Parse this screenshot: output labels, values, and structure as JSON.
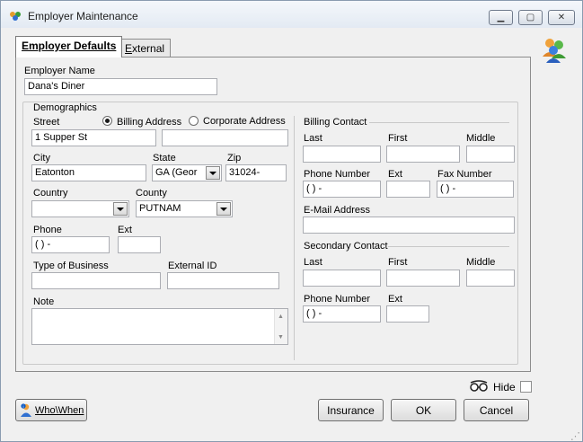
{
  "window": {
    "title": "Employer Maintenance",
    "min_glyph": "▁",
    "max_glyph": "▢",
    "close_glyph": "✕"
  },
  "tabs": {
    "active": "Employer Defaults",
    "inactive_first": "E",
    "inactive_rest": "xternal"
  },
  "employer": {
    "name_label": "Employer Name",
    "name_value": "Dana's Diner"
  },
  "demographics": {
    "title": "Demographics",
    "street_label": "Street",
    "billing_address": "Billing Address",
    "corporate_address": "Corporate Address",
    "street_value": "1 Supper St",
    "street2_value": "",
    "city_label": "City",
    "city_value": "Eatonton",
    "state_label": "State",
    "state_value": "GA  (Geor",
    "zip_label": "Zip",
    "zip_value": "31024-",
    "country_label": "Country",
    "country_value": "",
    "county_label": "County",
    "county_value": "PUTNAM",
    "phone_label": "Phone",
    "phone_value": "(   )    -",
    "ext_label": "Ext",
    "ext_value": "",
    "type_label": "Type of Business",
    "type_value": "",
    "external_id_label": "External ID",
    "external_id_value": "",
    "note_label": "Note",
    "note_value": ""
  },
  "billing_contact": {
    "title": "Billing Contact",
    "last_label": "Last",
    "first_label": "First",
    "middle_label": "Middle",
    "phone_label": "Phone Number",
    "ext_label": "Ext",
    "fax_label": "Fax Number",
    "phone_value": "(   )    -",
    "fax_value": "(   )    -",
    "email_label": "E-Mail Address"
  },
  "secondary_contact": {
    "title": "Secondary Contact",
    "last_label": "Last",
    "first_label": "First",
    "middle_label": "Middle",
    "phone_label": "Phone Number",
    "ext_label": "Ext",
    "phone_value": "(   )    -"
  },
  "footer": {
    "hide_label": "Hide",
    "whowhen_label": "Who\\When",
    "insurance_label": "Insurance",
    "ok_label": "OK",
    "cancel_label": "Cancel"
  },
  "scroll": {
    "up": "▲",
    "down": "▼"
  }
}
